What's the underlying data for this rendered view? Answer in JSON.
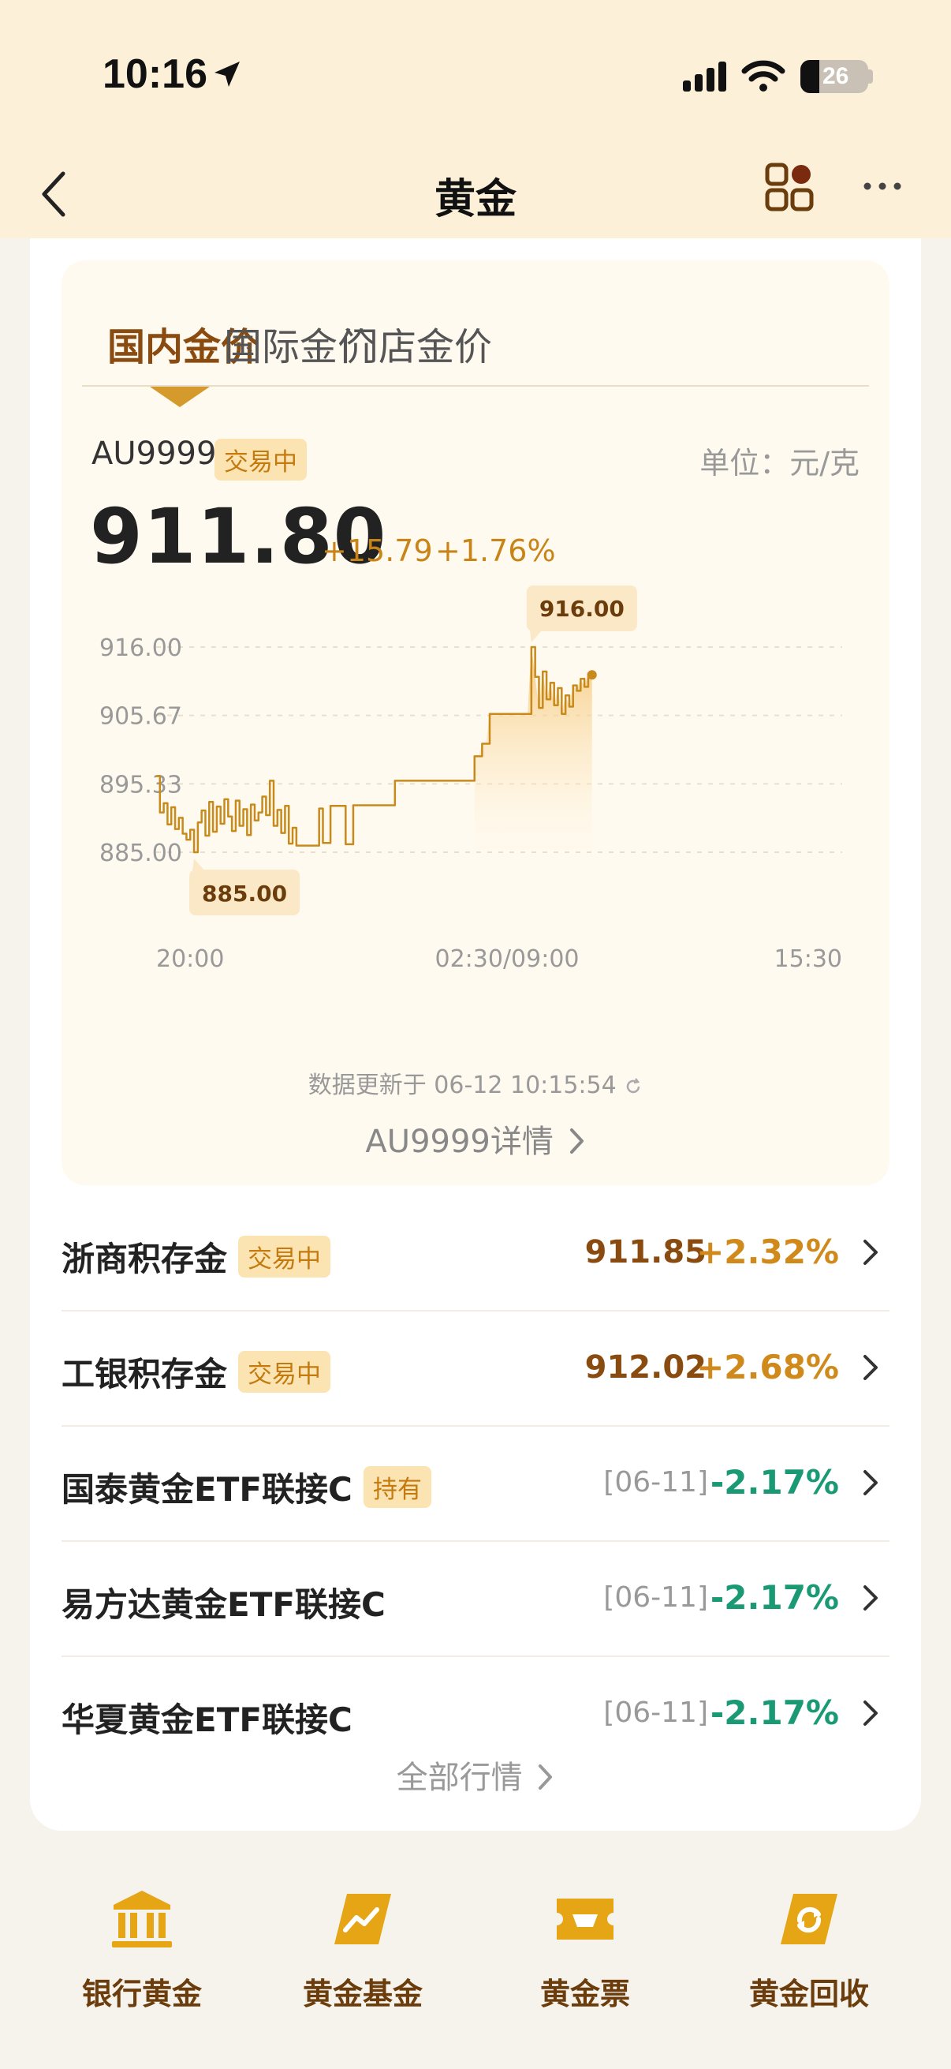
{
  "status_bar": {
    "time": "10:16",
    "battery": "26"
  },
  "nav": {
    "title": "黄金"
  },
  "tabs": [
    {
      "label": "国内金价",
      "active": true
    },
    {
      "label": "国际金价",
      "active": false
    },
    {
      "label": "门店金价",
      "active": false
    }
  ],
  "quote": {
    "symbol": "AU9999",
    "status": "交易中",
    "unit": "单位：元/克",
    "price": "911.80",
    "change": "+15.79",
    "change_pct": "+1.76%",
    "updated": "数据更新于 06-12 10:15:54",
    "detail_link": "AU9999详情"
  },
  "chart_data": {
    "type": "line",
    "y_ticks": [
      "916.00",
      "905.67",
      "895.33",
      "885.00"
    ],
    "ylim": [
      885.0,
      916.0
    ],
    "x_ticks": [
      "20:00",
      "02:30/09:00",
      "15:30"
    ],
    "max_label": "916.00",
    "min_label": "885.00",
    "series": [
      {
        "color": "#c98a1c",
        "values": [
          896.5,
          891.0,
          892.4,
          889.2,
          891.8,
          888.5,
          890.2,
          887.8,
          886.9,
          888.4,
          885.0,
          889.5,
          891.3,
          887.5,
          892.6,
          888.1,
          891.9,
          889.3,
          893.0,
          890.4,
          888.2,
          892.8,
          889.0,
          891.5,
          887.6,
          892.2,
          889.8,
          891.0,
          893.4,
          890.6,
          895.8,
          889.0,
          891.4,
          887.9,
          892.0,
          886.3,
          888.7,
          886.0,
          886.0,
          886.0,
          886.0,
          886.0,
          886.0,
          891.6,
          886.4,
          886.4,
          892.0,
          892.0,
          892.0,
          892.0,
          886.2,
          886.2,
          892.1,
          892.1,
          892.1,
          892.1,
          892.1,
          892.1,
          892.1,
          892.1,
          892.1,
          892.1,
          892.1,
          895.8,
          895.8,
          895.8,
          895.8,
          895.8,
          895.8,
          895.8,
          895.8,
          895.8,
          895.8,
          895.8,
          895.8,
          895.8,
          895.8,
          895.8,
          895.8,
          895.8,
          895.8,
          895.8,
          895.8,
          895.8,
          899.5,
          899.5,
          901.4,
          901.4,
          905.9,
          905.9,
          905.9,
          905.9,
          905.9,
          905.9,
          905.9,
          905.9,
          905.9,
          905.9,
          905.9,
          916.0,
          911.5,
          906.8,
          912.3,
          908.1,
          910.6,
          907.2,
          909.8,
          905.9,
          908.7,
          907.0,
          910.2,
          909.4,
          911.2,
          910.0,
          912.0,
          911.8
        ]
      }
    ]
  },
  "list": [
    {
      "name": "浙商积存金",
      "badge": "交易中",
      "value": "911.85",
      "pct": "+2.32%",
      "dir": "up"
    },
    {
      "name": "工银积存金",
      "badge": "交易中",
      "value": "912.02",
      "pct": "+2.68%",
      "dir": "up"
    },
    {
      "name": "国泰黄金ETF联接C",
      "badge": "持有",
      "date": "[06-11]",
      "pct": "-2.17%",
      "dir": "down"
    },
    {
      "name": "易方达黄金ETF联接C",
      "date": "[06-11]",
      "pct": "-2.17%",
      "dir": "down"
    },
    {
      "name": "华夏黄金ETF联接C",
      "date": "[06-11]",
      "pct": "-2.17%",
      "dir": "down"
    }
  ],
  "all_link": "全部行情",
  "bottom_nav": [
    {
      "label": "银行黄金",
      "icon": "bank-icon"
    },
    {
      "label": "黄金基金",
      "icon": "fund-chart-icon"
    },
    {
      "label": "黄金票",
      "icon": "ticket-icon"
    },
    {
      "label": "黄金回收",
      "icon": "recycle-icon"
    }
  ],
  "colors": {
    "accent": "#c98a1c",
    "up": "#d08a1b",
    "down": "#1a9a74",
    "header_bg": "#fdf0d8"
  }
}
